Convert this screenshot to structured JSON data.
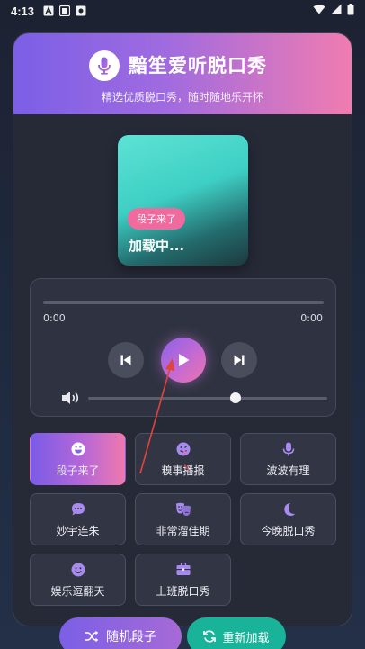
{
  "status_bar": {
    "time": "4:13"
  },
  "header": {
    "title": "黯笙爱听脱口秀",
    "subtitle": "精选优质脱口秀，随时随地乐开怀"
  },
  "cover": {
    "tag": "段子来了",
    "loading": "加载中..."
  },
  "player": {
    "current_time": "0:00",
    "total_time": "0:00",
    "progress": 0,
    "volume": 0.6
  },
  "categories": [
    {
      "label": "段子来了",
      "icon": "laugh-icon",
      "active": true
    },
    {
      "label": "糗事播报",
      "icon": "grin-tongue-icon",
      "active": false
    },
    {
      "label": "波波有理",
      "icon": "microphone-icon",
      "active": false
    },
    {
      "label": "妙宇连朱",
      "icon": "comment-dots-icon",
      "active": false
    },
    {
      "label": "非常溜佳期",
      "icon": "theater-masks-icon",
      "active": false
    },
    {
      "label": "今晚脱口秀",
      "icon": "moon-icon",
      "active": false
    },
    {
      "label": "娱乐逗翻天",
      "icon": "smile-icon",
      "active": false
    },
    {
      "label": "上班脱口秀",
      "icon": "briefcase-icon",
      "active": false
    }
  ],
  "buttons": {
    "random": "随机段子",
    "reload": "重新加载"
  },
  "colors": {
    "accent_purple": "#7b5fe6",
    "accent_pink": "#f07cb0",
    "accent_green": "#19b39a",
    "annotation": "#e0443a"
  }
}
